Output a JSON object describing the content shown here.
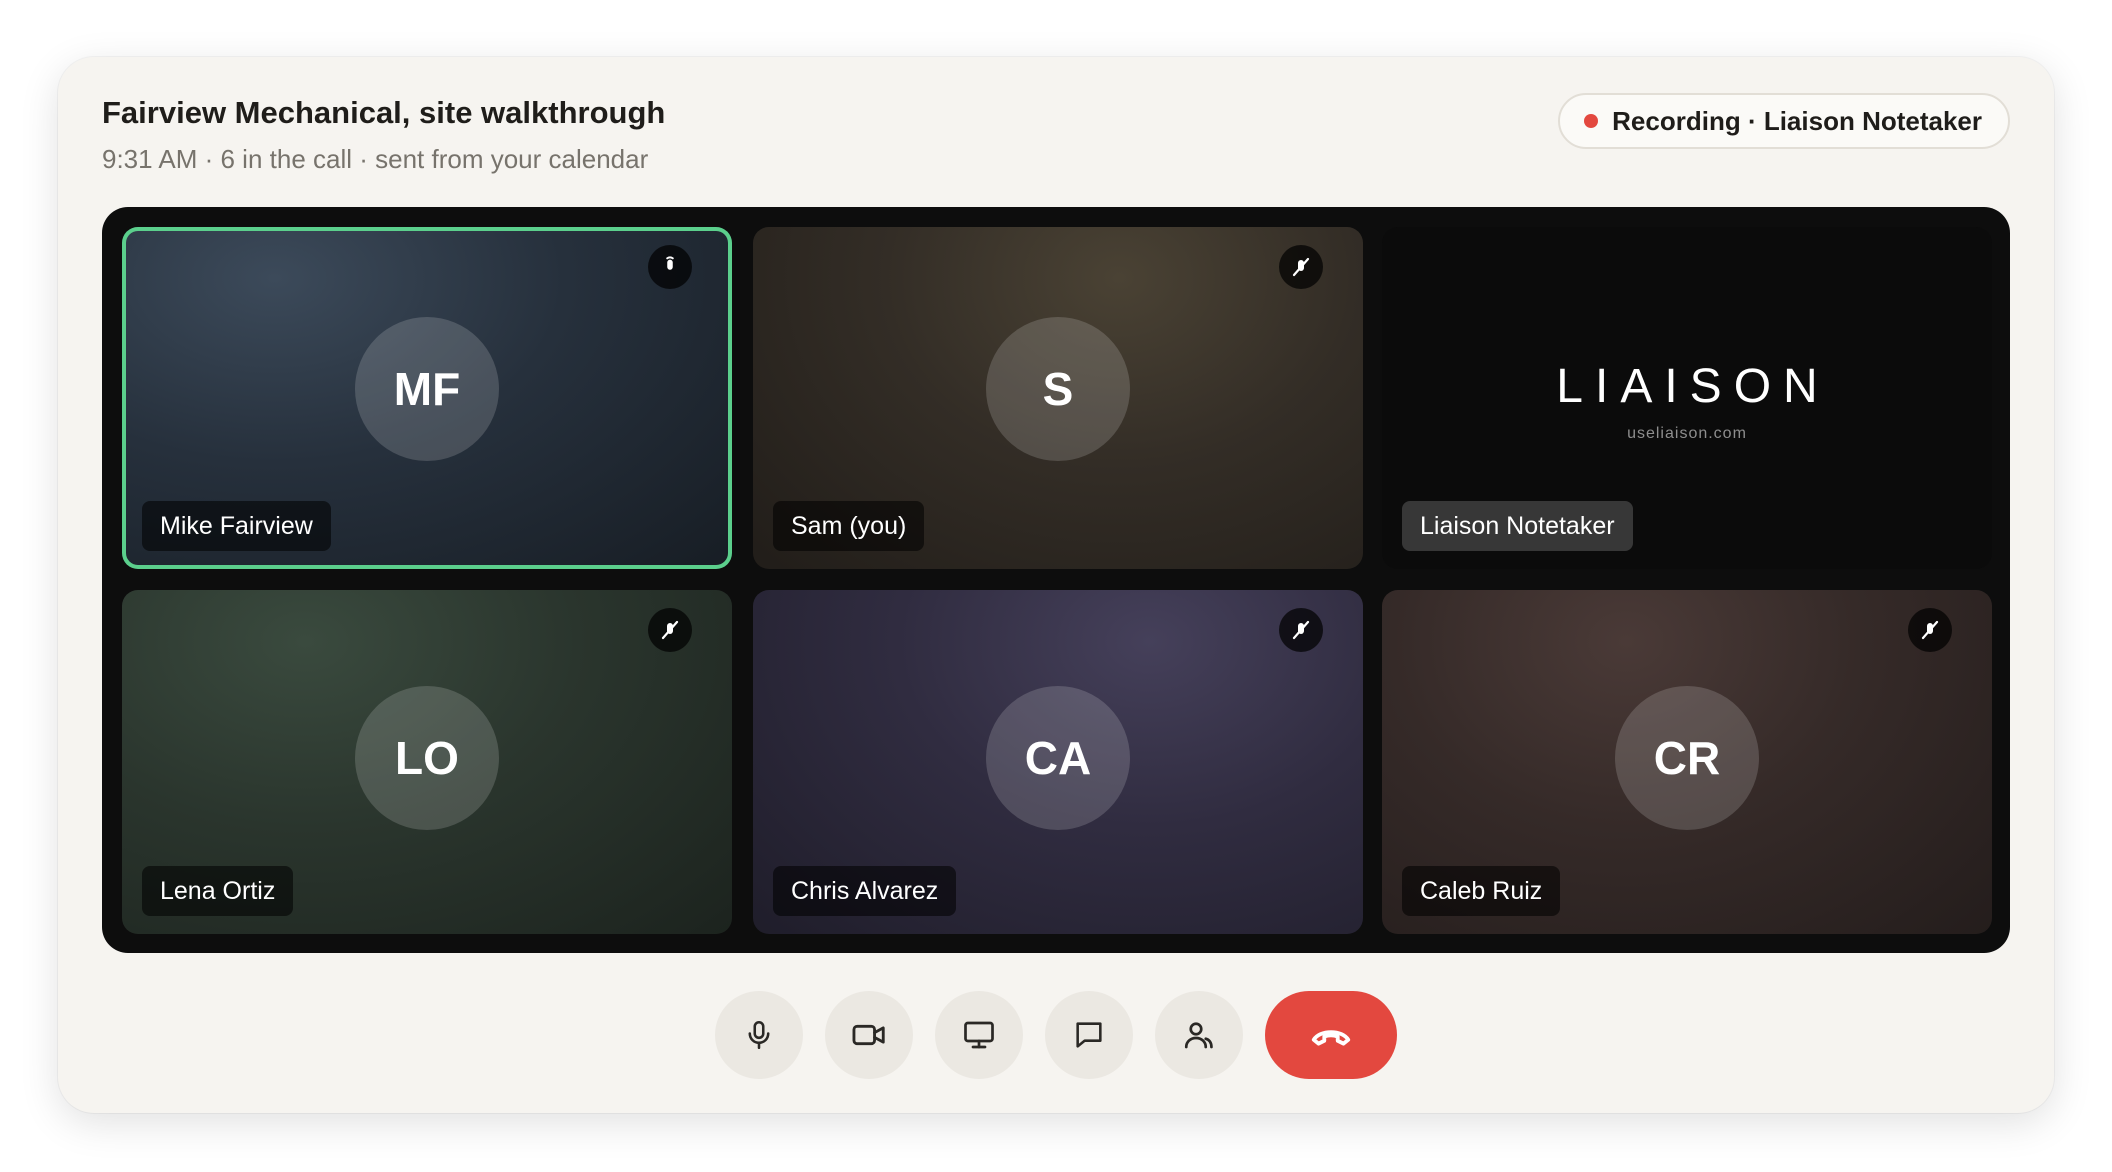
{
  "header": {
    "title": "Fairview Mechanical, site walkthrough",
    "subtitle": "9:31 AM · 6 in the call · sent from your calendar"
  },
  "recording": {
    "label": "Recording · Liaison Notetaker",
    "dot_color": "#e3483f"
  },
  "participants": [
    {
      "initials": "MF",
      "name": "Mike Fairview",
      "active_speaker": true,
      "muted": true,
      "mute_icon": "mic-off-icon"
    },
    {
      "initials": "S",
      "name": "Sam (you)",
      "active_speaker": false,
      "muted": true,
      "mute_icon": "mic-off-icon"
    },
    {
      "name": "Liaison Notetaker",
      "logo_text": "LIAISON",
      "logo_url": "useliaison.com"
    },
    {
      "initials": "LO",
      "name": "Lena Ortiz",
      "active_speaker": false,
      "muted": true,
      "mute_icon": "mic-off-icon"
    },
    {
      "initials": "CA",
      "name": "Chris Alvarez",
      "active_speaker": false,
      "muted": true,
      "mute_icon": "mic-off-icon"
    },
    {
      "initials": "CR",
      "name": "Caleb Ruiz",
      "active_speaker": false,
      "muted": true,
      "mute_icon": "mic-off-icon"
    }
  ],
  "colors": {
    "active_speaker_border": "#5bcf8c",
    "end_call": "#e3483f",
    "stage_background": "#0d0d0d"
  },
  "controls": [
    {
      "icon": "microphone-icon"
    },
    {
      "icon": "video-camera-icon"
    },
    {
      "icon": "screen-share-icon"
    },
    {
      "icon": "chat-icon"
    },
    {
      "icon": "participants-icon"
    },
    {
      "icon": "end-call-icon"
    }
  ]
}
